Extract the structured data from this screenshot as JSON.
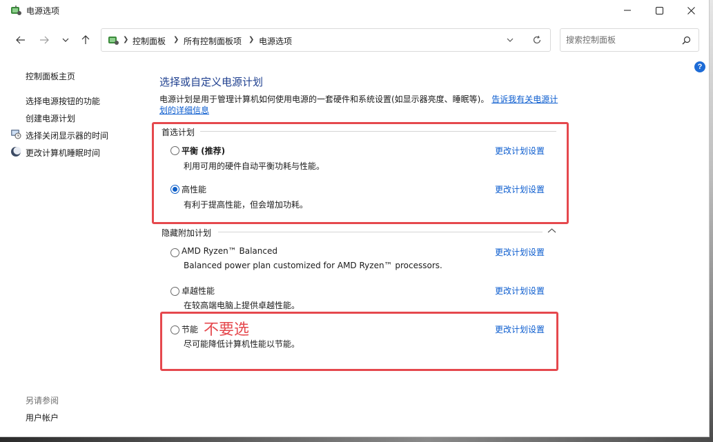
{
  "window": {
    "title": "电源选项"
  },
  "address": {
    "crumbs": [
      "控制面板",
      "所有控制面板项",
      "电源选项"
    ]
  },
  "search": {
    "placeholder": "搜索控制面板"
  },
  "help": {
    "label": "?"
  },
  "sidebar": {
    "home": "控制面板主页",
    "items": [
      {
        "label": "选择电源按钮的功能",
        "icon": "none"
      },
      {
        "label": "创建电源计划",
        "icon": "none"
      },
      {
        "label": "选择关闭显示器的时间",
        "icon": "monitor-clock-icon"
      },
      {
        "label": "更改计算机睡眠时间",
        "icon": "moon-icon"
      }
    ],
    "see_also_heading": "另请参阅",
    "see_also": [
      "用户帐户"
    ]
  },
  "main": {
    "title": "选择或自定义电源计划",
    "description": "电源计划是用于管理计算机如何使用电源的一套硬件和系统设置(如显示器亮度、睡眠等)。",
    "description_link": "告诉我有关电源计划的详细信息",
    "preferred_heading": "首选计划",
    "hidden_heading": "隐藏附加计划",
    "change_link": "更改计划设置",
    "plans": [
      {
        "name": "平衡 (推荐)",
        "desc": "利用可用的硬件自动平衡功耗与性能。",
        "selected": false
      },
      {
        "name": "高性能",
        "desc": "有利于提高性能，但会增加功耗。",
        "selected": true
      },
      {
        "name": "AMD Ryzen™ Balanced",
        "desc": "Balanced power plan customized for AMD Ryzen™ processors.",
        "selected": false
      },
      {
        "name": "卓越性能",
        "desc": "在较高端电脑上提供卓越性能。",
        "selected": false
      },
      {
        "name": "节能",
        "desc": "尽可能降低计算机性能以节能。",
        "selected": false
      }
    ],
    "annotation": "不要选"
  },
  "colors": {
    "accent": "#1060c8",
    "link": "#0b5ccf",
    "title": "#1e3f8f",
    "annotation": "#e5484d"
  }
}
